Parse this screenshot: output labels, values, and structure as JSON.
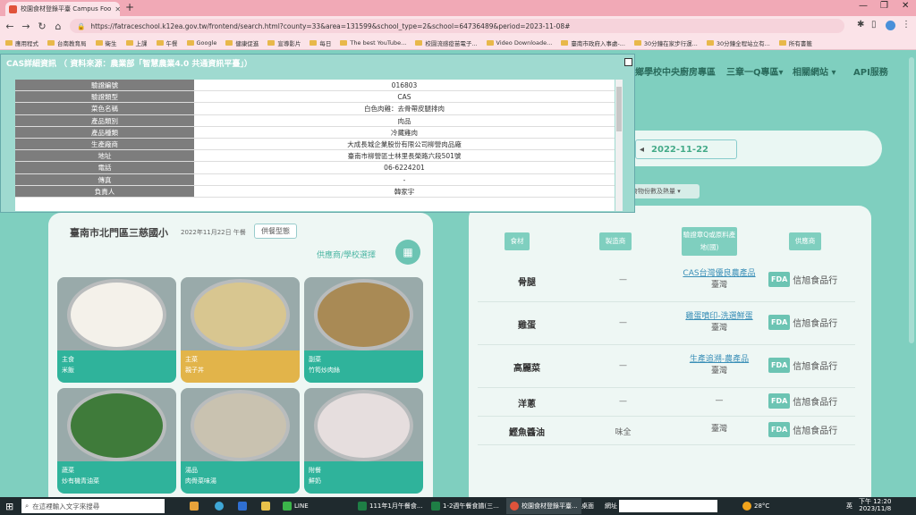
{
  "browser": {
    "tab_title": "校園食材登錄平臺 Campus Foo",
    "url": "https://fatraceschool.k12ea.gov.tw/frontend/search.html?county=33&area=131599&school_type=2&school=64736489&period=2023-11-08#",
    "bookmarks": [
      "應用程式",
      "台南教育局",
      "衛生",
      "上課",
      "午餐",
      "Google",
      "健康促進",
      "宣導影片",
      "每日",
      "The best YouTube...",
      "校園流感疫苗電子...",
      "Video Downloade...",
      "臺南市政府入事處-...",
      "30分鐘在家步行運...",
      "30分鐘全程站立有...",
      "所有書籤"
    ]
  },
  "site_nav": [
    "偏鄉學校中央廚房專區",
    "三章一Q專區▾",
    "相關網站 ▾",
    "API服務"
  ],
  "modal": {
    "title": "CAS詳細資訊 （ 資料來源：農業部「智慧農業4.0 共通資訊平臺」）",
    "rows": [
      {
        "k": "驗證編號",
        "v": "016803"
      },
      {
        "k": "驗證類型",
        "v": "CAS"
      },
      {
        "k": "菜色名稱",
        "v": "白色肉雞：去骨帶皮腿排肉"
      },
      {
        "k": "產品類別",
        "v": "肉品"
      },
      {
        "k": "產品種類",
        "v": "冷藏雞肉"
      },
      {
        "k": "生產廠商",
        "v": "大成長城企業股份有限公司柳營肉品廠"
      },
      {
        "k": "地址",
        "v": "臺南市柳營區士林里長榮路六段501號"
      },
      {
        "k": "電話",
        "v": "06-6224201"
      },
      {
        "k": "傳真",
        "v": "-"
      },
      {
        "k": "負責人",
        "v": "韓家宇"
      }
    ]
  },
  "date": {
    "value": "2022-11-22",
    "prev": "◂",
    "filter": "食物份數及熱量 ▾"
  },
  "school": {
    "name": "臺南市北門區三慈國小",
    "date": "2022年11月22日 午餐",
    "btn": "供餐型態",
    "supplier_select": "供應商/學校選擇"
  },
  "dishes": [
    {
      "type": "主食",
      "name": "米飯",
      "color": "#2fb39b",
      "bowl": "#f4f1ea"
    },
    {
      "type": "主菜",
      "name": "親子丼",
      "color": "#e2b44a",
      "bowl": "#d8c690"
    },
    {
      "type": "副菜",
      "name": "竹筍炒肉絲",
      "color": "#2fb39b",
      "bowl": "#a98a55"
    },
    {
      "type": "蔬菜",
      "name": "炒有機青油菜",
      "color": "#2fb39b",
      "bowl": "#3f7b3a"
    },
    {
      "type": "湯品",
      "name": "肉骨菜味湯",
      "color": "#2fb39b",
      "bowl": "#c9c2b0"
    },
    {
      "type": "附餐",
      "name": "鮮奶",
      "color": "#2fb39b",
      "bowl": "#e6dede"
    }
  ],
  "table": {
    "headers": [
      "食材",
      "製造商",
      "驗證章Q或原料產地(國)",
      "供應商"
    ],
    "rows": [
      {
        "name": "骨腿",
        "maker": "—",
        "cert_link": "CAS台灣優良農產品",
        "origin": "臺灣",
        "fda": "FDA",
        "supplier": "信旭食品行"
      },
      {
        "name": "雞蛋",
        "maker": "—",
        "cert_link": "雞蛋噴印-洗選鮮蛋",
        "origin": "臺灣",
        "fda": "FDA",
        "supplier": "信旭食品行"
      },
      {
        "name": "高麗菜",
        "maker": "—",
        "cert_link": "生產追溯-農產品",
        "origin": "臺灣",
        "fda": "FDA",
        "supplier": "信旭食品行"
      },
      {
        "name": "洋蔥",
        "maker": "—",
        "cert_link": "",
        "origin": "—",
        "fda": "FDA",
        "supplier": "信旭食品行"
      },
      {
        "name": "鰹魚醬油",
        "maker": "味全",
        "cert_link": "",
        "origin": "臺灣",
        "fda": "FDA",
        "supplier": "信旭食品行"
      }
    ]
  },
  "taskbar": {
    "search": "在這裡輸入文字來搜尋",
    "apps": [
      "LINE",
      "111年1月午餐食...",
      "1-2週午餐食譜(三...",
      "校園食材登錄平臺..."
    ],
    "desktop": "桌面",
    "address": "網址",
    "weather": "28°C",
    "ime": "英",
    "time": "下午 12:20",
    "date": "2023/11/8"
  }
}
